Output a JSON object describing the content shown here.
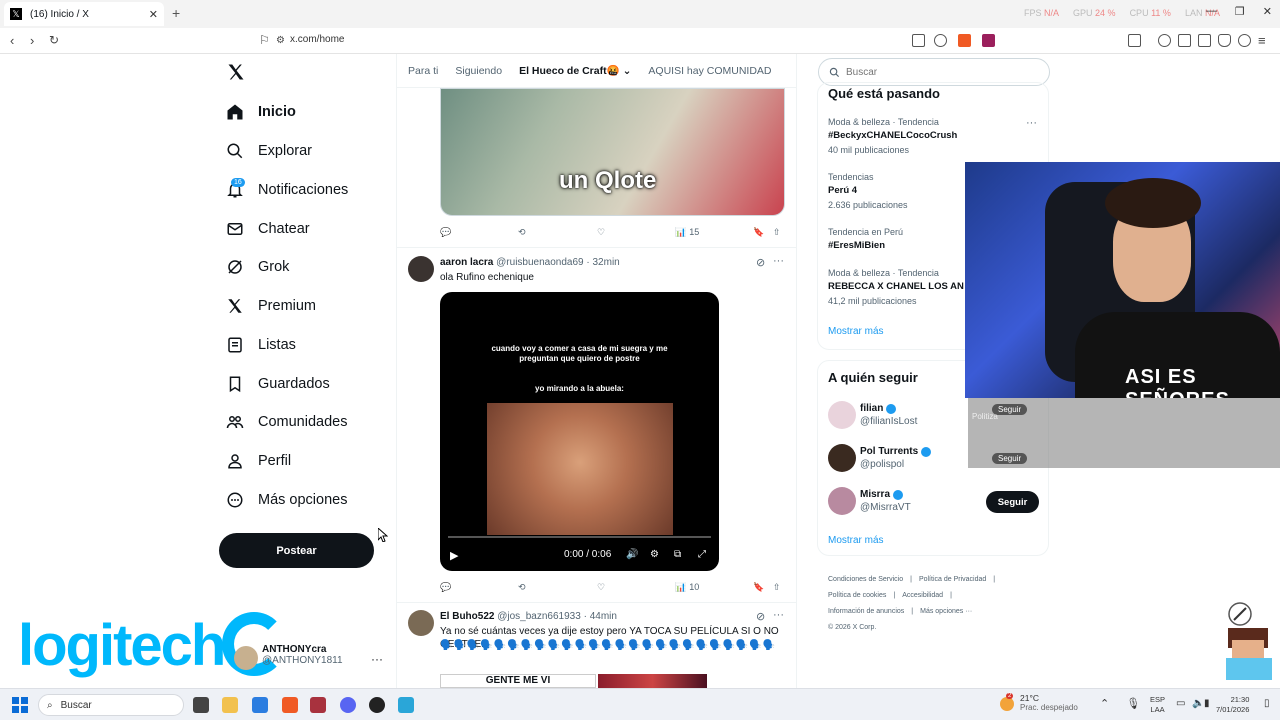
{
  "browser": {
    "tab_title": "(16) Inicio / X",
    "tab_icon": "x-logo-icon",
    "url": "x.com/home",
    "perf": {
      "fps_label": "FPS",
      "fps": "N/A",
      "gpu_label": "GPU",
      "gpu": "24 %",
      "cpu_label": "CPU",
      "cpu": "11 %",
      "lan_label": "LAN",
      "lan": "N/A"
    }
  },
  "sidebar": {
    "items": [
      {
        "label": "Inicio",
        "icon": "home-icon",
        "active": true
      },
      {
        "label": "Explorar",
        "icon": "search-icon"
      },
      {
        "label": "Notificaciones",
        "icon": "bell-icon",
        "badge": "16"
      },
      {
        "label": "Chatear",
        "icon": "mail-icon"
      },
      {
        "label": "Grok",
        "icon": "grok-icon"
      },
      {
        "label": "Premium",
        "icon": "x-premium-icon"
      },
      {
        "label": "Listas",
        "icon": "list-icon"
      },
      {
        "label": "Guardados",
        "icon": "bookmark-icon"
      },
      {
        "label": "Comunidades",
        "icon": "communities-icon"
      },
      {
        "label": "Perfil",
        "icon": "person-icon"
      },
      {
        "label": "Más opciones",
        "icon": "more-circle-icon"
      }
    ],
    "post_button": "Postear",
    "profile": {
      "name": "ANTHONYcra",
      "handle": "@ANTHONY1811"
    }
  },
  "overlay": {
    "logitech": "logitech"
  },
  "feed": {
    "tabs": [
      {
        "label": "Para ti"
      },
      {
        "label": "Siguiendo"
      },
      {
        "label": "El Hueco de Craft🤬",
        "active": true
      },
      {
        "label": "AQUISI hay COMUNIDAD"
      }
    ],
    "tweet1": {
      "image_caption": "un Qlote",
      "views": "15"
    },
    "tweet2": {
      "name": "aaron lacra",
      "handle": "@ruisbuenaonda69",
      "time": "· 32min",
      "text": "ola Rufino echenique",
      "video_text": "cuando voy a comer a casa de mi suegra y me preguntan que quiero de postre",
      "video_text2": "yo mirando a la abuela:",
      "video_time": "0:00 / 0:06",
      "views": "10"
    },
    "tweet3": {
      "name": "El Buho522",
      "handle": "@jos_bazn661933",
      "time": "· 44min",
      "text": "Ya no sé cuántas veces ya dije estoy pero YA TOCA SU PELÍCULA SI O NO GENTEEE",
      "emoji_row": "🗣️🗣️🗣️🗣️🗣️🗣️🗣️🗣️🗣️🗣️🗣️🗣️🗣️🗣️🗣️🗣️🗣️🗣️🗣️🗣️🗣️🗣️🗣️🗣️🗣️",
      "thumb_text": "GENTE ME VI"
    }
  },
  "right": {
    "search_placeholder": "Buscar",
    "trends_title": "Qué está pasando",
    "trends": [
      {
        "category": "Moda & belleza · Tendencia",
        "name": "#BeckyxCHANELCocoCrush",
        "count": "40 mil publicaciones"
      },
      {
        "category": "Tendencias",
        "name": "Perú 4",
        "count": "2.636 publicaciones"
      },
      {
        "category": "Tendencia en Perú",
        "name": "#EresMiBien",
        "count": ""
      },
      {
        "category": "Moda & belleza · Tendencia",
        "name": "REBECCA X CHANEL LOS AN",
        "count": "41,2 mil publicaciones"
      }
    ],
    "show_more": "Mostrar más",
    "follow_title": "A quién seguir",
    "follow": [
      {
        "name": "filian",
        "handle": "@filianIsLost"
      },
      {
        "name": "Pol Turrents",
        "handle": "@polispol"
      },
      {
        "name": "Misrra",
        "handle": "@MisrraVT"
      }
    ],
    "follow_button": "Seguir",
    "show_more2": "Mostrar más",
    "footer": {
      "links": [
        "Condiciones de Servicio",
        "|",
        "Política de Privacidad",
        "|",
        "Política de cookies",
        "|",
        "Accesibilidad",
        "|",
        "Información de anuncios",
        "|",
        "Más opciones ···"
      ],
      "copyright": "© 2026 X Corp."
    }
  },
  "webcam": {
    "shirt_text": "ASI ES SEÑORES"
  },
  "chat": [
    "Seguir",
    "Politiza",
    "Seguir"
  ],
  "taskbar": {
    "search": "Buscar",
    "weather_temp": "21°C",
    "weather_desc": "Prac. despejado",
    "weather_badge": "2",
    "lang1": "ESP",
    "lang2": "LAA",
    "time": "21:30",
    "date": "7/01/2026"
  }
}
